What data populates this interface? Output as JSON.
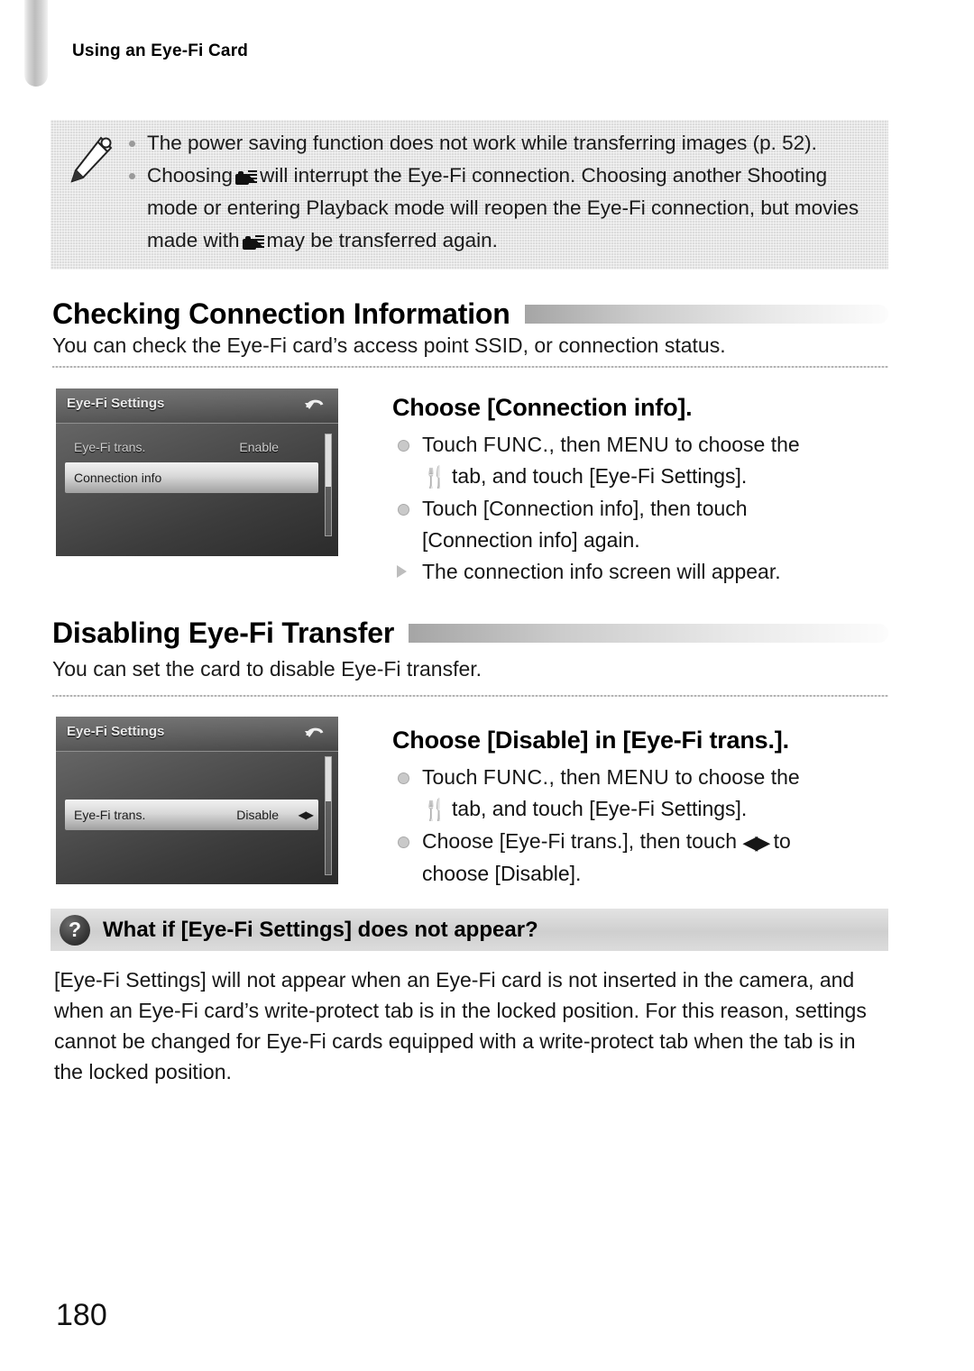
{
  "running_header": "Using an Eye-Fi Card",
  "note_box": {
    "icon": "pencil-icon",
    "items": [
      {
        "text_before": "The power saving function does not work while transferring images (p. 52).",
        "icon": null,
        "text_after": ""
      },
      {
        "text_before": "Choosing",
        "icon": "movie-mode-icon",
        "text_after": "will interrupt the Eye-Fi connection. Choosing another Shooting mode or entering Playback mode will reopen the Eye-Fi connection, but movies made with",
        "icon2": "movie-mode-icon",
        "text_end": "may be transferred again."
      }
    ]
  },
  "sections": [
    {
      "heading": "Checking Connection Information",
      "description": "You can check the Eye-Fi card’s access point SSID, or connection status.",
      "screen": {
        "title": "Eye-Fi Settings",
        "return_icon": "return-icon",
        "rows": [
          {
            "label": "Eye-Fi trans.",
            "value": "Enable",
            "selected": false,
            "arrows": ""
          },
          {
            "label": "Connection info",
            "value": "",
            "selected": true,
            "arrows": ""
          }
        ]
      },
      "step": {
        "title": "Choose [Connection info].",
        "lines": [
          {
            "marker": "bullet",
            "segments": [
              {
                "type": "text",
                "value": "Touch "
              },
              {
                "type": "caps",
                "value": "FUNC."
              },
              {
                "type": "text",
                "value": ", then "
              },
              {
                "type": "caps",
                "value": "MENU"
              },
              {
                "type": "text",
                "value": " to choose the"
              }
            ]
          },
          {
            "marker": "none",
            "segments": [
              {
                "type": "icon",
                "value": "settings-tab-icon"
              },
              {
                "type": "text",
                "value": " tab, and touch [Eye-Fi Settings]."
              }
            ]
          },
          {
            "marker": "bullet",
            "segments": [
              {
                "type": "text",
                "value": "Touch [Connection info], then touch"
              }
            ]
          },
          {
            "marker": "none",
            "segments": [
              {
                "type": "text",
                "value": "[Connection info] again."
              }
            ]
          },
          {
            "marker": "triangle",
            "segments": [
              {
                "type": "text",
                "value": "The connection info screen will appear."
              }
            ]
          }
        ]
      }
    },
    {
      "heading": "Disabling Eye-Fi Transfer",
      "description": "You can set the card to disable Eye-Fi transfer.",
      "screen": {
        "title": "Eye-Fi Settings",
        "return_icon": "return-icon",
        "rows": [
          {
            "label": "Eye-Fi trans.",
            "value": "Disable",
            "selected": true,
            "arrows": "◀▶"
          }
        ]
      },
      "step": {
        "title": "Choose [Disable] in [Eye-Fi trans.].",
        "lines": [
          {
            "marker": "bullet",
            "segments": [
              {
                "type": "text",
                "value": "Touch "
              },
              {
                "type": "caps",
                "value": "FUNC."
              },
              {
                "type": "text",
                "value": ", then "
              },
              {
                "type": "caps",
                "value": "MENU"
              },
              {
                "type": "text",
                "value": " to choose the"
              }
            ]
          },
          {
            "marker": "none",
            "segments": [
              {
                "type": "icon",
                "value": "settings-tab-icon"
              },
              {
                "type": "text",
                "value": " tab, and touch [Eye-Fi Settings]."
              }
            ]
          },
          {
            "marker": "bullet",
            "segments": [
              {
                "type": "text",
                "value": "Choose [Eye-Fi trans.], then touch "
              },
              {
                "type": "lr",
                "value": "◀▶"
              },
              {
                "type": "text",
                "value": " to"
              }
            ]
          },
          {
            "marker": "none",
            "segments": [
              {
                "type": "text",
                "value": "choose [Disable]."
              }
            ]
          }
        ]
      }
    }
  ],
  "qa": {
    "icon": "question-mark-icon",
    "mark": "?",
    "title": "What if [Eye-Fi Settings] does not appear?",
    "body": "[Eye-Fi Settings] will not appear when an Eye-Fi card is not inserted in the camera, and when an Eye-Fi card’s write-protect tab is in the locked position. For this reason, settings cannot be changed for Eye-Fi cards equipped with a write-protect tab when the tab is in the locked position."
  },
  "page_number": "180"
}
